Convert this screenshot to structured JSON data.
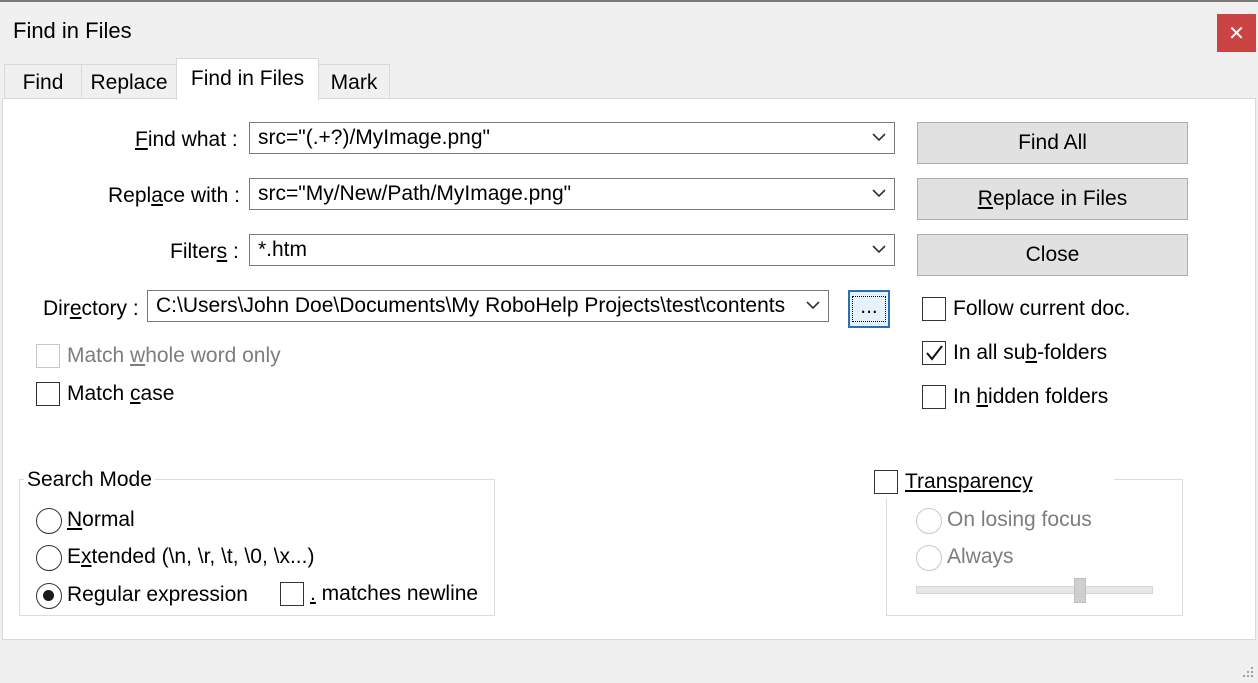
{
  "window": {
    "title": "Find in Files",
    "close_glyph": "✕"
  },
  "tabs": [
    {
      "label": "Find"
    },
    {
      "label": "Replace"
    },
    {
      "label": "Find in Files",
      "active": true
    },
    {
      "label": "Mark"
    }
  ],
  "fields": {
    "find_what": {
      "label_pre": "",
      "label_u": "F",
      "label_post": "ind what :",
      "value": "src=\"(.+?)/MyImage.png\""
    },
    "replace_with": {
      "label_pre": "Repl",
      "label_u": "a",
      "label_post": "ce with :",
      "value": "src=\"My/New/Path/MyImage.png\""
    },
    "filters": {
      "label_pre": "Filter",
      "label_u": "s",
      "label_post": " :",
      "value": "*.htm"
    },
    "directory": {
      "label_pre": "Dir",
      "label_u": "e",
      "label_post": "ctory :",
      "value": "C:\\Users\\John Doe\\Documents\\My RoboHelp Projects\\test\\contents"
    }
  },
  "buttons": {
    "find_all": "Find All",
    "replace_in_files_u": "R",
    "replace_in_files_rest": "eplace in Files",
    "close": "Close",
    "browse": "..."
  },
  "options": {
    "match_whole_word": {
      "pre": "Match ",
      "u": "w",
      "post": "hole word only",
      "checked": false,
      "enabled": false
    },
    "match_case": {
      "pre": "Match ",
      "u": "c",
      "post": "ase",
      "checked": false,
      "enabled": true
    },
    "follow_current_doc": {
      "label": "Follow current doc.",
      "checked": false
    },
    "in_all_subfolders": {
      "pre": "In all su",
      "u": "b",
      "post": "-folders",
      "checked": true
    },
    "in_hidden_folders": {
      "pre": "In ",
      "u": "h",
      "post": "idden folders",
      "checked": false
    }
  },
  "search_mode": {
    "title": "Search Mode",
    "normal": {
      "u": "N",
      "post": "ormal",
      "selected": false
    },
    "extended": {
      "pre": "E",
      "u": "x",
      "post": "tended (\\n, \\r, \\t, \\0, \\x...)",
      "selected": false
    },
    "regex": {
      "pre": "Re",
      "u": "g",
      "post": "ular expression",
      "selected": true
    },
    "dot_matches_newline": {
      "u": ".",
      "post": " matches newline",
      "checked": false
    }
  },
  "transparency": {
    "label": "Transparency",
    "checked": false,
    "on_losing_focus": "On losing focus",
    "always": "Always",
    "level": 0.7
  },
  "colors": {
    "close_button": "#c94443",
    "focus_border": "#2a6fb8",
    "disabled_text": "#7d7d7d"
  }
}
